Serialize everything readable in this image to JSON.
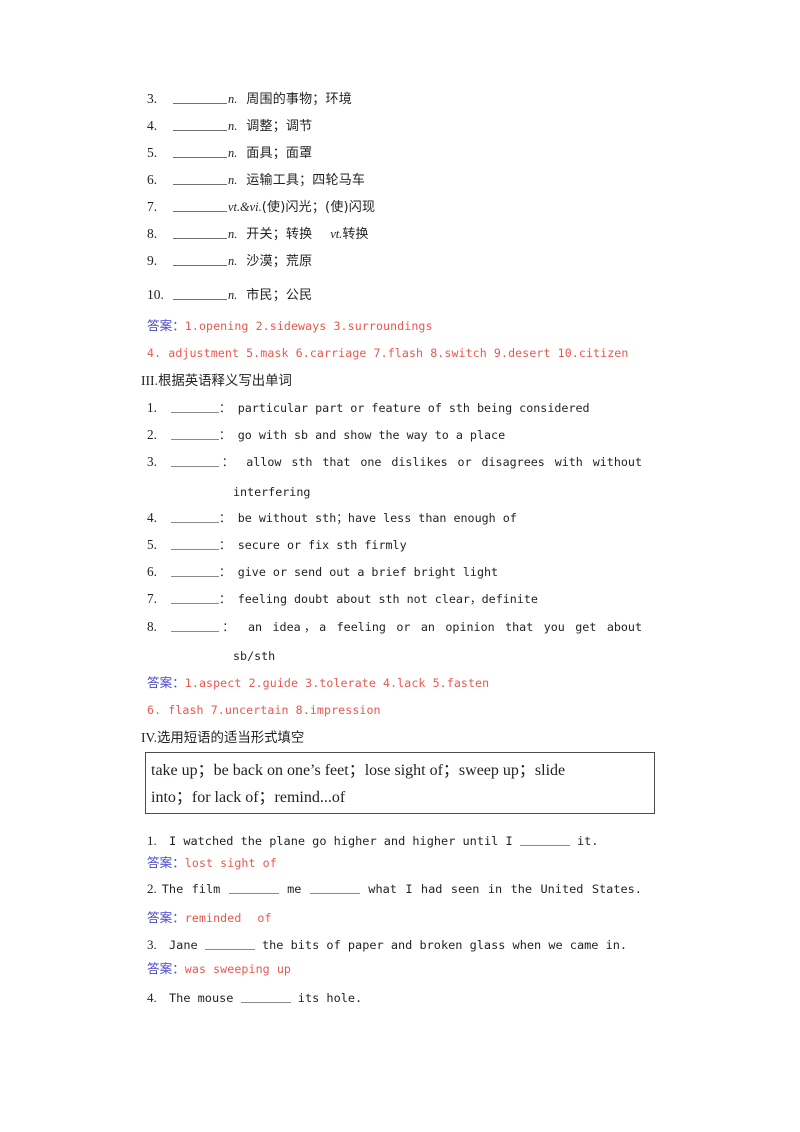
{
  "vocab_section": {
    "items": [
      {
        "num": "3.",
        "pos": "n.",
        "cn": "周围的事物；环境",
        "pos2": "",
        "cn2": ""
      },
      {
        "num": "4.",
        "pos": "n.",
        "cn": "调整；调节",
        "pos2": "",
        "cn2": ""
      },
      {
        "num": "5.",
        "pos": "n.",
        "cn": "面具；面罩",
        "pos2": "",
        "cn2": ""
      },
      {
        "num": "6.",
        "pos": "n.",
        "cn": "运输工具；四轮马车",
        "pos2": "",
        "cn2": ""
      },
      {
        "num": "7.",
        "pos": "vt.&vi.",
        "cn": "(使)闪光；(使)闪现",
        "pos2": "",
        "cn2": ""
      },
      {
        "num": "8.",
        "pos": "n.",
        "cn": "开关；转换",
        "pos2": "vt.",
        "cn2": "转换"
      },
      {
        "num": "9.",
        "pos": "n.",
        "cn": "沙漠；荒原",
        "pos2": "",
        "cn2": ""
      },
      {
        "num": "10.",
        "pos": "n.",
        "cn": "市民；公民",
        "pos2": "",
        "cn2": ""
      }
    ],
    "answer_label": "答案：",
    "answers_line1": "1.opening   2.sideways   3.surroundings",
    "answers_line2": "4. adjustment   5.mask   6.carriage   7.flash   8.switch   9.desert   10.citizen"
  },
  "section3": {
    "numeral": "III",
    "heading_dot": ".",
    "heading": "根据英语释义写出单词",
    "items": [
      {
        "num": "1.",
        "def": "： particular part or feature of sth being considered"
      },
      {
        "num": "2.",
        "def": "： go with sb and show the way to a place"
      },
      {
        "num": "3.",
        "def": "： allow sth that one dislikes or disagrees with without"
      },
      {
        "num": "4.",
        "def": "： be without sth；have less than enough of"
      },
      {
        "num": "5.",
        "def": "： secure or fix sth firmly"
      },
      {
        "num": "6.",
        "def": "： give or send out a brief bright light"
      },
      {
        "num": "7.",
        "def": "： feeling doubt about sth not clear，definite"
      },
      {
        "num": "8.",
        "def": "： an idea，a feeling or an opinion that you get about"
      }
    ],
    "cont_item3": "interfering",
    "cont_item8": "sb/sth",
    "answer_label": "答案：",
    "answers_line1": "1.aspect   2.guide   3.tolerate   4.lack   5.fasten",
    "answers_line2": "6. flash   7.uncertain   8.impression"
  },
  "section4": {
    "numeral": "IV",
    "heading_dot": ".",
    "heading": "选用短语的适当形式填空",
    "phrase_box": {
      "line1": "take up；be back on one’s feet；lose sight of；sweep up；slide",
      "line2": "into；for lack of；remind...of"
    },
    "exercises": [
      {
        "num": "1.",
        "before": "I watched the plane go higher and higher until I",
        "after": "it.",
        "answer_label": "答案：",
        "answer": "lost sight of",
        "blanks": 1
      },
      {
        "num": "2.",
        "before": "The film",
        "middle": "me",
        "after": "what I had seen in the United States.",
        "answer_label": "答案：",
        "answer_part1": "reminded",
        "answer_part2": "of",
        "blanks": 2
      },
      {
        "num": "3.",
        "before": "Jane",
        "after": "the bits of paper and broken glass when we came in.",
        "answer_label": "答案：",
        "answer": "was sweeping up",
        "blanks": 1
      },
      {
        "num": "4.",
        "before": "The mouse",
        "after": "its hole.",
        "answer_label": "",
        "answer": "",
        "blanks": 1
      }
    ]
  },
  "colors": {
    "text": "#231f20",
    "answer_label": "#4848c8",
    "answer_value": "#e8584f",
    "box_border": "#4d4d4d",
    "blank_rule": "#8a8a8a"
  }
}
